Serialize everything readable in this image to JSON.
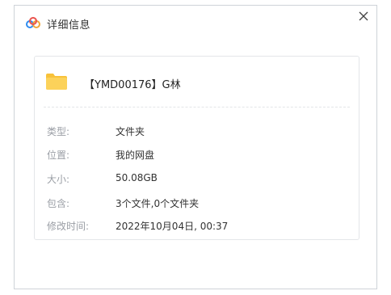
{
  "dialog": {
    "title": "详细信息",
    "close_symbol": "×",
    "icons": {
      "app": "baidu-netdisk-cloud-icon",
      "folder": "folder-icon",
      "close": "close-icon"
    },
    "colors": {
      "folder": "#f8c23a",
      "cloud_blue": "#2f8cf0",
      "label": "#9a9ea5",
      "value": "#333333",
      "border": "#e4e6e9"
    }
  },
  "item": {
    "name": "【YMD00176】G林"
  },
  "properties": [
    {
      "label": "类型:",
      "value": "文件夹"
    },
    {
      "label": "位置:",
      "value": "我的网盘"
    },
    {
      "label": "大小:",
      "value": "50.08GB"
    },
    {
      "label": "包含:",
      "value": "3个文件,0个文件夹"
    },
    {
      "label": "修改时间:",
      "value": "2022年10月04日, 00:37"
    }
  ]
}
